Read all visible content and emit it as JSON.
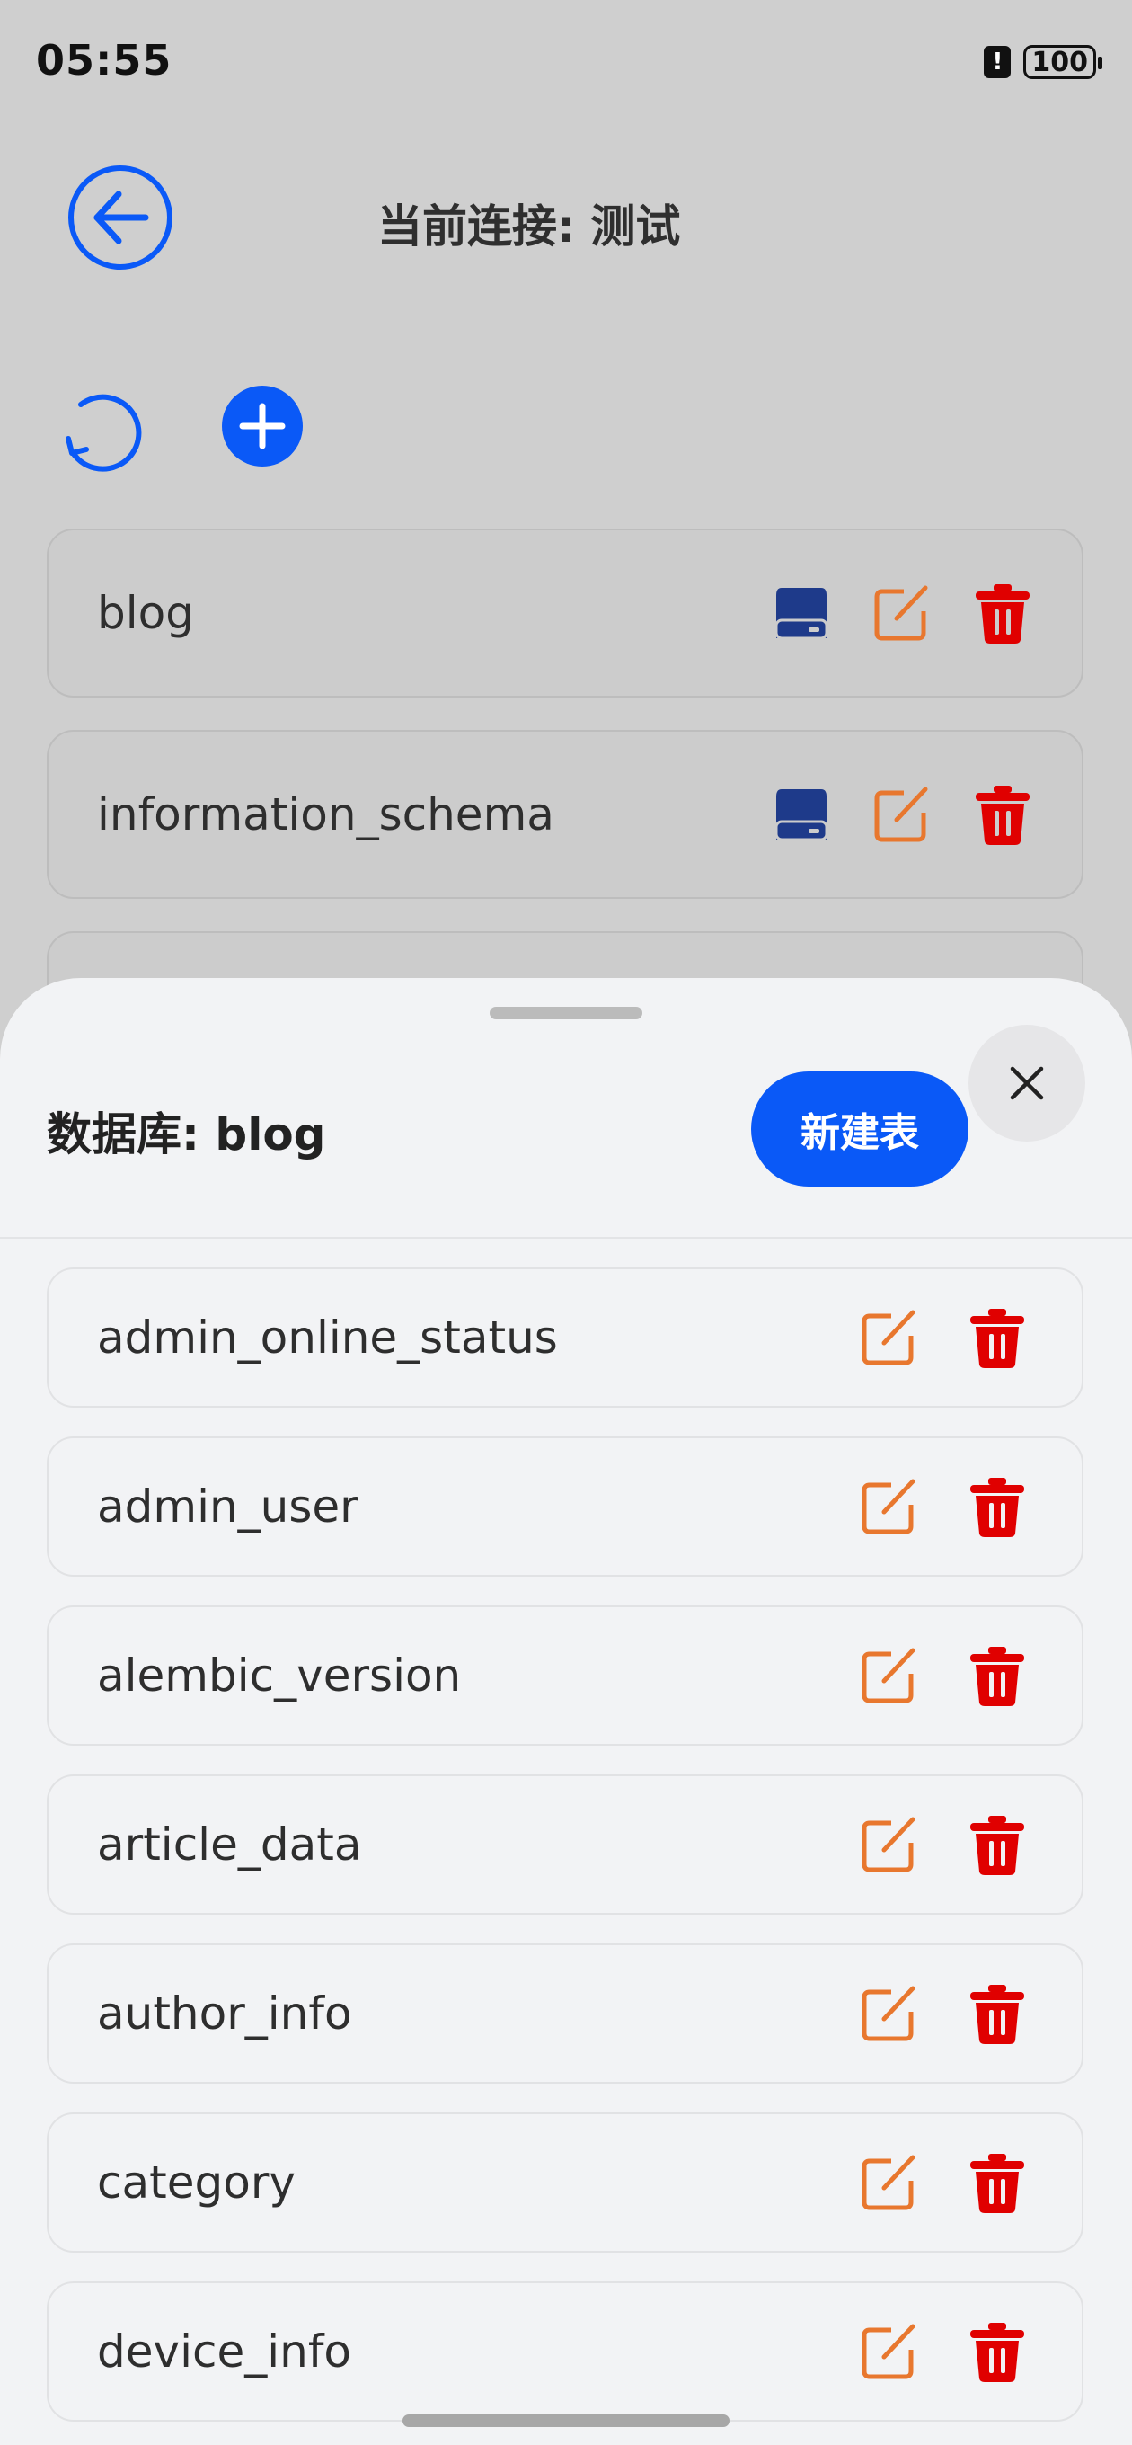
{
  "status_bar": {
    "time": "05:55",
    "alert_symbol": "!",
    "battery": "100"
  },
  "header": {
    "title": "当前连接: 测试",
    "back_icon": "arrow-left-circle-icon"
  },
  "toolbar": {
    "refresh_icon": "refresh-icon",
    "add_icon": "plus-circle-icon"
  },
  "databases": [
    {
      "name": "blog"
    },
    {
      "name": "information_schema"
    }
  ],
  "sheet": {
    "title": "数据库: blog",
    "new_table_label": "新建表",
    "close_icon": "close-icon",
    "tables": [
      {
        "name": "admin_online_status"
      },
      {
        "name": "admin_user"
      },
      {
        "name": "alembic_version"
      },
      {
        "name": "article_data"
      },
      {
        "name": "author_info"
      },
      {
        "name": "category"
      },
      {
        "name": "device_info"
      }
    ]
  },
  "colors": {
    "accent": "#0a59f7",
    "dark_blue": "#1e3a8a",
    "edit": "#e8772e",
    "delete": "#e00000"
  }
}
